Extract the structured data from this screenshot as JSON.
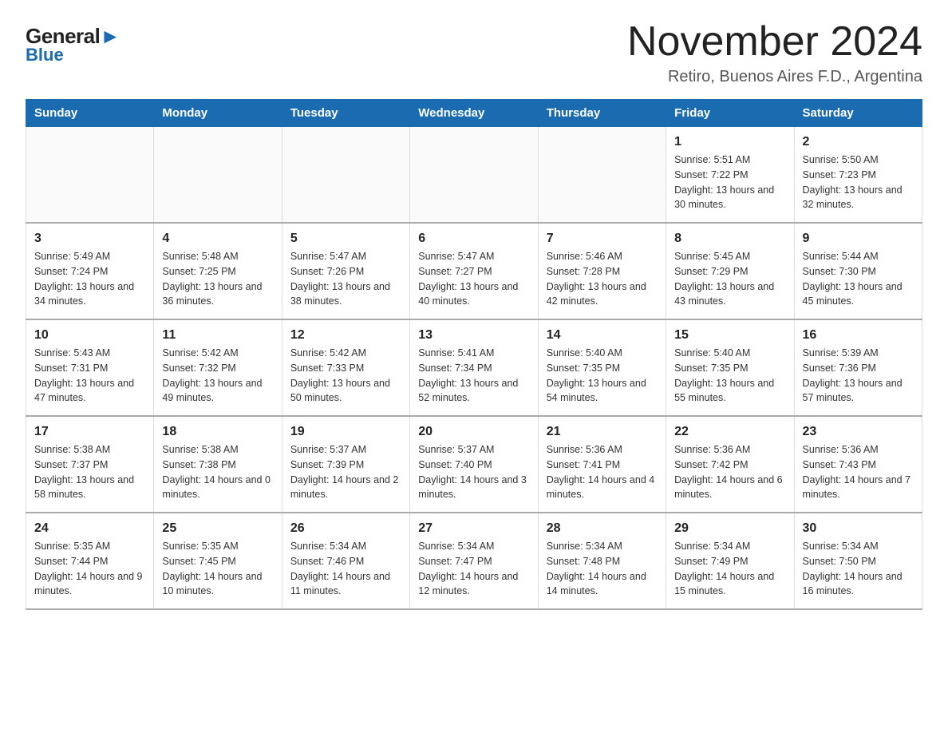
{
  "logo": {
    "general": "General",
    "blue_highlight": "▶",
    "blue": "Blue"
  },
  "header": {
    "title": "November 2024",
    "subtitle": "Retiro, Buenos Aires F.D., Argentina"
  },
  "days_of_week": [
    "Sunday",
    "Monday",
    "Tuesday",
    "Wednesday",
    "Thursday",
    "Friday",
    "Saturday"
  ],
  "weeks": [
    [
      {
        "day": "",
        "info": ""
      },
      {
        "day": "",
        "info": ""
      },
      {
        "day": "",
        "info": ""
      },
      {
        "day": "",
        "info": ""
      },
      {
        "day": "",
        "info": ""
      },
      {
        "day": "1",
        "info": "Sunrise: 5:51 AM\nSunset: 7:22 PM\nDaylight: 13 hours and 30 minutes."
      },
      {
        "day": "2",
        "info": "Sunrise: 5:50 AM\nSunset: 7:23 PM\nDaylight: 13 hours and 32 minutes."
      }
    ],
    [
      {
        "day": "3",
        "info": "Sunrise: 5:49 AM\nSunset: 7:24 PM\nDaylight: 13 hours and 34 minutes."
      },
      {
        "day": "4",
        "info": "Sunrise: 5:48 AM\nSunset: 7:25 PM\nDaylight: 13 hours and 36 minutes."
      },
      {
        "day": "5",
        "info": "Sunrise: 5:47 AM\nSunset: 7:26 PM\nDaylight: 13 hours and 38 minutes."
      },
      {
        "day": "6",
        "info": "Sunrise: 5:47 AM\nSunset: 7:27 PM\nDaylight: 13 hours and 40 minutes."
      },
      {
        "day": "7",
        "info": "Sunrise: 5:46 AM\nSunset: 7:28 PM\nDaylight: 13 hours and 42 minutes."
      },
      {
        "day": "8",
        "info": "Sunrise: 5:45 AM\nSunset: 7:29 PM\nDaylight: 13 hours and 43 minutes."
      },
      {
        "day": "9",
        "info": "Sunrise: 5:44 AM\nSunset: 7:30 PM\nDaylight: 13 hours and 45 minutes."
      }
    ],
    [
      {
        "day": "10",
        "info": "Sunrise: 5:43 AM\nSunset: 7:31 PM\nDaylight: 13 hours and 47 minutes."
      },
      {
        "day": "11",
        "info": "Sunrise: 5:42 AM\nSunset: 7:32 PM\nDaylight: 13 hours and 49 minutes."
      },
      {
        "day": "12",
        "info": "Sunrise: 5:42 AM\nSunset: 7:33 PM\nDaylight: 13 hours and 50 minutes."
      },
      {
        "day": "13",
        "info": "Sunrise: 5:41 AM\nSunset: 7:34 PM\nDaylight: 13 hours and 52 minutes."
      },
      {
        "day": "14",
        "info": "Sunrise: 5:40 AM\nSunset: 7:35 PM\nDaylight: 13 hours and 54 minutes."
      },
      {
        "day": "15",
        "info": "Sunrise: 5:40 AM\nSunset: 7:35 PM\nDaylight: 13 hours and 55 minutes."
      },
      {
        "day": "16",
        "info": "Sunrise: 5:39 AM\nSunset: 7:36 PM\nDaylight: 13 hours and 57 minutes."
      }
    ],
    [
      {
        "day": "17",
        "info": "Sunrise: 5:38 AM\nSunset: 7:37 PM\nDaylight: 13 hours and 58 minutes."
      },
      {
        "day": "18",
        "info": "Sunrise: 5:38 AM\nSunset: 7:38 PM\nDaylight: 14 hours and 0 minutes."
      },
      {
        "day": "19",
        "info": "Sunrise: 5:37 AM\nSunset: 7:39 PM\nDaylight: 14 hours and 2 minutes."
      },
      {
        "day": "20",
        "info": "Sunrise: 5:37 AM\nSunset: 7:40 PM\nDaylight: 14 hours and 3 minutes."
      },
      {
        "day": "21",
        "info": "Sunrise: 5:36 AM\nSunset: 7:41 PM\nDaylight: 14 hours and 4 minutes."
      },
      {
        "day": "22",
        "info": "Sunrise: 5:36 AM\nSunset: 7:42 PM\nDaylight: 14 hours and 6 minutes."
      },
      {
        "day": "23",
        "info": "Sunrise: 5:36 AM\nSunset: 7:43 PM\nDaylight: 14 hours and 7 minutes."
      }
    ],
    [
      {
        "day": "24",
        "info": "Sunrise: 5:35 AM\nSunset: 7:44 PM\nDaylight: 14 hours and 9 minutes."
      },
      {
        "day": "25",
        "info": "Sunrise: 5:35 AM\nSunset: 7:45 PM\nDaylight: 14 hours and 10 minutes."
      },
      {
        "day": "26",
        "info": "Sunrise: 5:34 AM\nSunset: 7:46 PM\nDaylight: 14 hours and 11 minutes."
      },
      {
        "day": "27",
        "info": "Sunrise: 5:34 AM\nSunset: 7:47 PM\nDaylight: 14 hours and 12 minutes."
      },
      {
        "day": "28",
        "info": "Sunrise: 5:34 AM\nSunset: 7:48 PM\nDaylight: 14 hours and 14 minutes."
      },
      {
        "day": "29",
        "info": "Sunrise: 5:34 AM\nSunset: 7:49 PM\nDaylight: 14 hours and 15 minutes."
      },
      {
        "day": "30",
        "info": "Sunrise: 5:34 AM\nSunset: 7:50 PM\nDaylight: 14 hours and 16 minutes."
      }
    ]
  ]
}
